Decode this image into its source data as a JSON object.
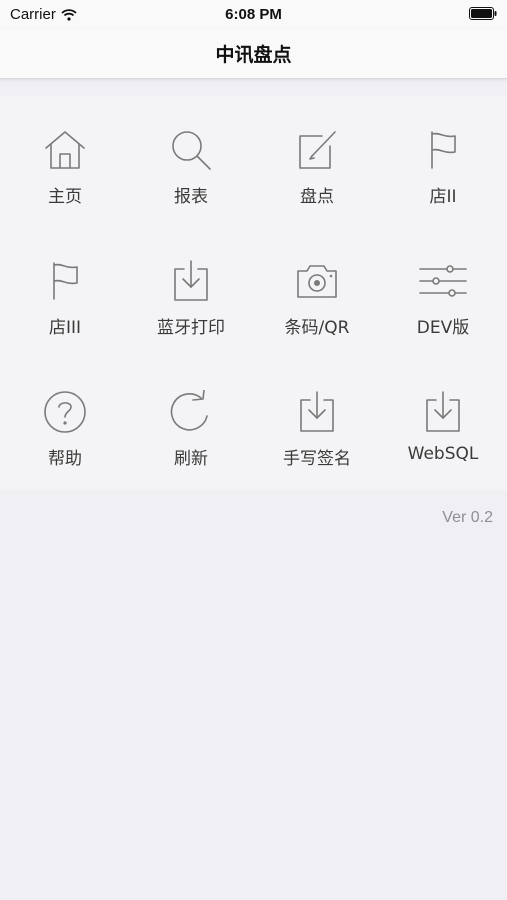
{
  "status_bar": {
    "carrier": "Carrier",
    "time": "6:08 PM",
    "wifi_icon": "wifi-icon",
    "battery_icon": "battery-icon"
  },
  "nav": {
    "title": "中讯盘点"
  },
  "menu": [
    {
      "label": "主页",
      "icon": "home-icon"
    },
    {
      "label": "报表",
      "icon": "search-icon"
    },
    {
      "label": "盘点",
      "icon": "edit-icon"
    },
    {
      "label": "店II",
      "icon": "flag-icon"
    },
    {
      "label": "店III",
      "icon": "flag-icon"
    },
    {
      "label": "蓝牙打印",
      "icon": "download-icon"
    },
    {
      "label": "条码/QR",
      "icon": "camera-icon"
    },
    {
      "label": "DEV版",
      "icon": "sliders-icon"
    },
    {
      "label": "帮助",
      "icon": "help-icon"
    },
    {
      "label": "刷新",
      "icon": "refresh-icon"
    },
    {
      "label": "手写签名",
      "icon": "download-icon"
    },
    {
      "label": "WebSQL",
      "icon": "download-icon"
    }
  ],
  "version": "Ver 0.2",
  "colors": {
    "background": "#efeff4",
    "grid_background": "#f4f4f6",
    "icon_stroke": "#7a7a7a",
    "version_text": "#8e8e93"
  }
}
